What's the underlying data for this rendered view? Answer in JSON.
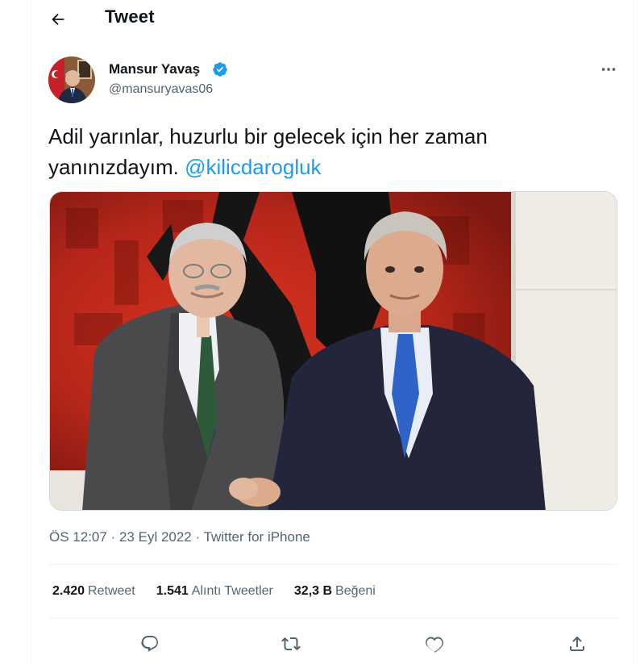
{
  "header": {
    "title": "Tweet",
    "back_icon": "arrow-left-icon"
  },
  "author": {
    "name": "Mansur Yavaş",
    "handle": "@mansuryavas06",
    "verified": true,
    "verified_icon": "verified-badge-icon",
    "more_icon": "more-horizontal-icon"
  },
  "tweet": {
    "text": "Adil yarınlar, huzurlu bir gelecek için her zaman yanınızdayım.",
    "mention": "@kilicdarogluk",
    "media_alt": "photo"
  },
  "meta": {
    "time": "ÖS 12:07",
    "date": "23 Eyl 2022",
    "separator": "·",
    "source": "Twitter for iPhone"
  },
  "stats": {
    "retweets_count": "2.420",
    "retweets_label": "Retweet",
    "quotes_count": "1.541",
    "quotes_label": "Alıntı Tweetler",
    "likes_count": "32,3 B",
    "likes_label": "Beğeni"
  },
  "actions": [
    {
      "name": "reply-icon"
    },
    {
      "name": "retweet-icon"
    },
    {
      "name": "like-icon"
    },
    {
      "name": "share-icon"
    }
  ],
  "colors": {
    "accent": "#1d9bf0",
    "text": "#0f1419",
    "secondary": "#536471",
    "border": "#eff3f4"
  }
}
